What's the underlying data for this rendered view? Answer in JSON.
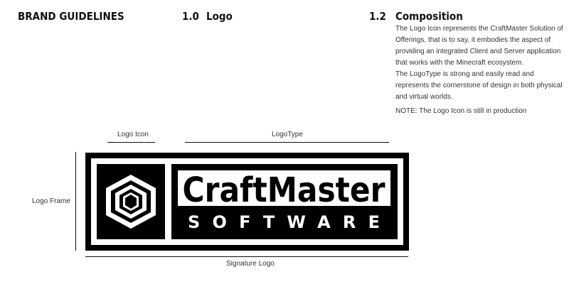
{
  "header": {
    "brand_title": "BRAND GUIDELINES",
    "section_number": "1.0",
    "section_title": "Logo",
    "subsection_number": "1.2",
    "subsection_title": "Composition"
  },
  "composition": {
    "paragraph_1": "The Logo Icon represents the CraftMaster Solution of Offerings, that is to say, it embodies the aspect of providing an integrated Client and Server application that works with the Minecraft ecosystem.",
    "paragraph_2": "The LogoType is strong and easily read and represents the cornerstone of design in both physical and virtual worlds.",
    "note": "NOTE: The Logo Icon is still in production"
  },
  "diagram": {
    "logo_icon_label": "Logo Icon",
    "logotype_label": "LogoType",
    "logo_frame_label": "Logo Frame",
    "signature_logo_label": "Signature Logo"
  },
  "logo": {
    "wordmark": "CraftMaster",
    "subtitle": "SOFTWARE"
  },
  "colors": {
    "logo_black": "#000000",
    "logo_white": "#ffffff",
    "text": "#333333"
  }
}
